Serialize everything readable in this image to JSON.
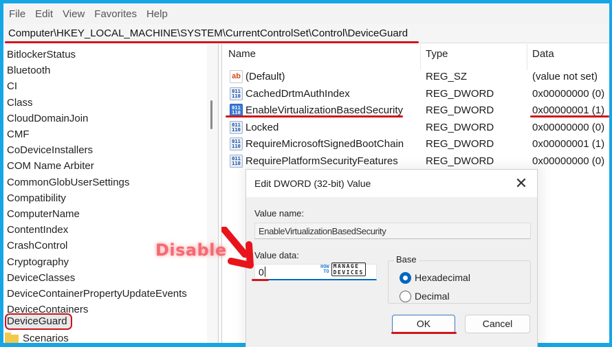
{
  "menu": [
    "File",
    "Edit",
    "View",
    "Favorites",
    "Help"
  ],
  "address": "Computer\\HKEY_LOCAL_MACHINE\\SYSTEM\\CurrentControlSet\\Control\\DeviceGuard",
  "tree": {
    "items": [
      "BitlockerStatus",
      "Bluetooth",
      "CI",
      "Class",
      "CloudDomainJoin",
      "CMF",
      "CoDeviceInstallers",
      "COM Name Arbiter",
      "CommonGlobUserSettings",
      "Compatibility",
      "ComputerName",
      "ContentIndex",
      "CrashControl",
      "Cryptography",
      "DeviceClasses",
      "DeviceContainerPropertyUpdateEvents",
      "DeviceContainers",
      "DeviceGuard"
    ],
    "selected": "DeviceGuard",
    "child": "Scenarios"
  },
  "values": {
    "columns": [
      "Name",
      "Type",
      "Data"
    ],
    "rows": [
      {
        "icon": "string-value-icon",
        "name": "(Default)",
        "type": "REG_SZ",
        "data": "(value not set)"
      },
      {
        "icon": "dword-value-icon",
        "name": "CachedDrtmAuthIndex",
        "type": "REG_DWORD",
        "data": "0x00000000 (0)"
      },
      {
        "icon": "dword-value-icon",
        "name": "EnableVirtualizationBasedSecurity",
        "type": "REG_DWORD",
        "data": "0x00000001 (1)"
      },
      {
        "icon": "dword-value-icon",
        "name": "Locked",
        "type": "REG_DWORD",
        "data": "0x00000000 (0)"
      },
      {
        "icon": "dword-value-icon",
        "name": "RequireMicrosoftSignedBootChain",
        "type": "REG_DWORD",
        "data": "0x00000001 (1)"
      },
      {
        "icon": "dword-value-icon",
        "name": "RequirePlatformSecurityFeatures",
        "type": "REG_DWORD",
        "data": "0x00000000 (0)"
      }
    ]
  },
  "dialog": {
    "title": "Edit DWORD (32-bit) Value",
    "value_name_label": "Value name:",
    "value_name": "EnableVirtualizationBasedSecurity",
    "value_data_label": "Value data:",
    "value_data": "0",
    "base_label": "Base",
    "base_options": [
      {
        "label": "Hexadecimal",
        "checked": true
      },
      {
        "label": "Decimal",
        "checked": false
      }
    ],
    "ok_label": "OK",
    "cancel_label": "Cancel"
  },
  "watermark": {
    "how": "HOW",
    "to": "TO",
    "manage": "MANAGE",
    "devices": "DEVICES"
  },
  "annotation": {
    "text": "Disable",
    "color": "#f26b73"
  },
  "colors": {
    "frame": "#16a6e6",
    "highlight": "#d0161b",
    "accent": "#0067c0"
  }
}
